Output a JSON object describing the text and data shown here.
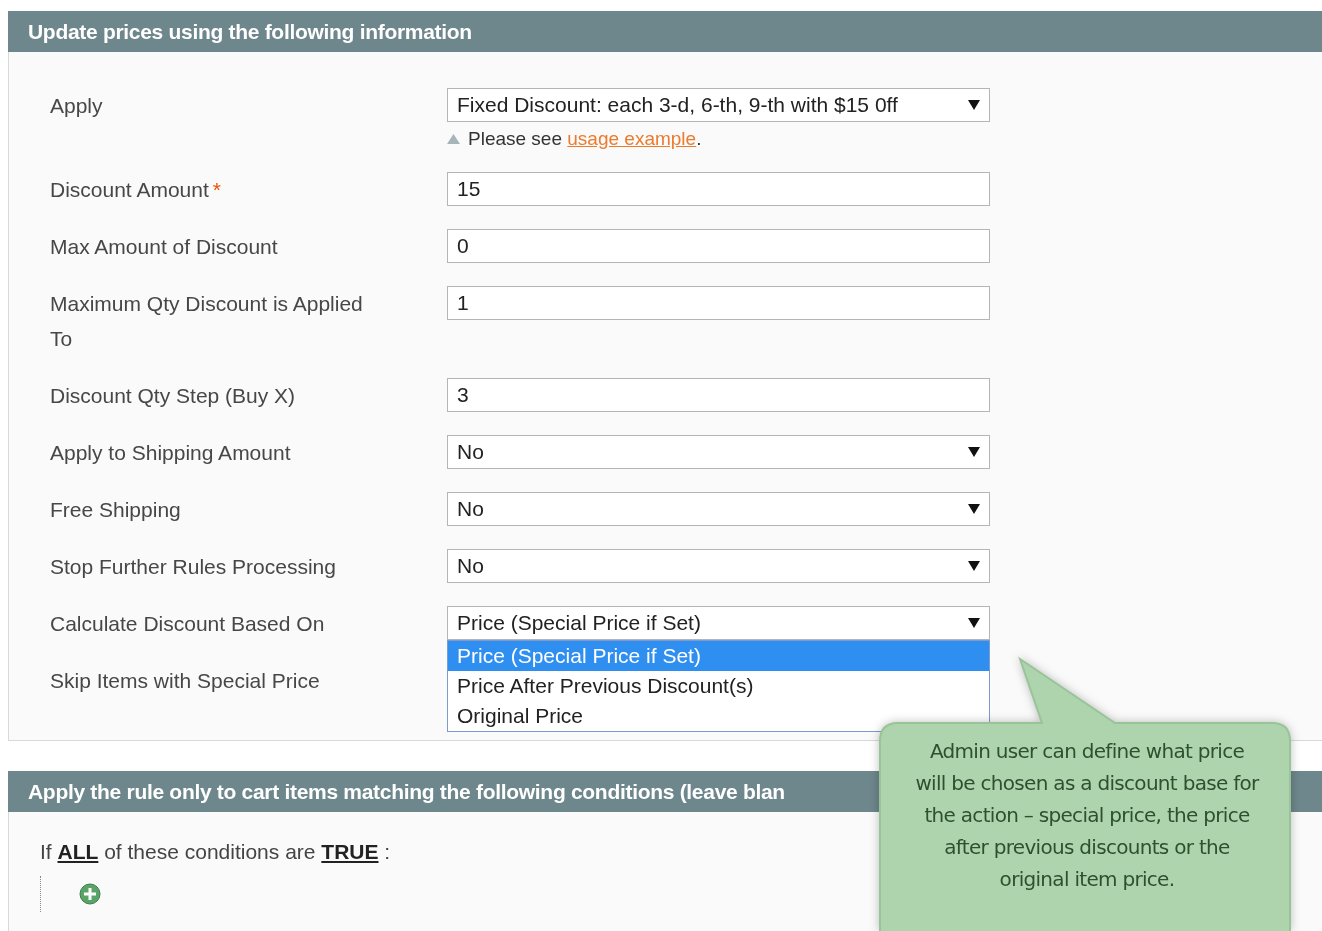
{
  "sections": [
    {
      "title": "Update prices using the following information",
      "rows": [
        {
          "label": "Apply",
          "kind": "select",
          "value": "Fixed Discount: each 3-d, 6-th, 9-th with $15 0ff",
          "hint": {
            "text": "Please see ",
            "link": "usage example",
            "after": "."
          }
        },
        {
          "label": "Discount Amount",
          "marker": "*",
          "kind": "text",
          "value": "15"
        },
        {
          "label": "Max Amount of Discount",
          "kind": "text",
          "value": "0"
        },
        {
          "label": "Maximum Qty Discount is Applied To",
          "kind": "text",
          "value": "1"
        },
        {
          "label": "Discount Qty Step (Buy X)",
          "kind": "text",
          "value": "3"
        },
        {
          "label": "Apply to Shipping Amount",
          "kind": "select",
          "value": "No"
        },
        {
          "label": "Free Shipping",
          "kind": "select",
          "value": "No"
        },
        {
          "label": "Stop Further Rules Processing",
          "kind": "select",
          "value": "No"
        },
        {
          "label": "Calculate Discount Based On",
          "kind": "select",
          "value": "Price (Special Price if Set)",
          "expanded": true,
          "options": [
            {
              "label": "Price (Special Price if Set)",
              "selected": true
            },
            {
              "label": "Price After Previous Discount(s)",
              "selected": false
            },
            {
              "label": "Original Price",
              "selected": false
            }
          ]
        },
        {
          "label": "Skip Items with Special Price",
          "kind": "label"
        }
      ]
    },
    {
      "title": "Apply the rule only to cart items matching the following conditions (leave blan",
      "conditions": {
        "prefix": "If ",
        "aggregator": "ALL",
        "middle": " of these conditions are ",
        "value": "TRUE",
        "suffix": " :"
      }
    }
  ],
  "callout": {
    "text": "Admin user can define what price will be chosen as a discount base for the action – special price, the price after previous discounts or the original item price."
  }
}
